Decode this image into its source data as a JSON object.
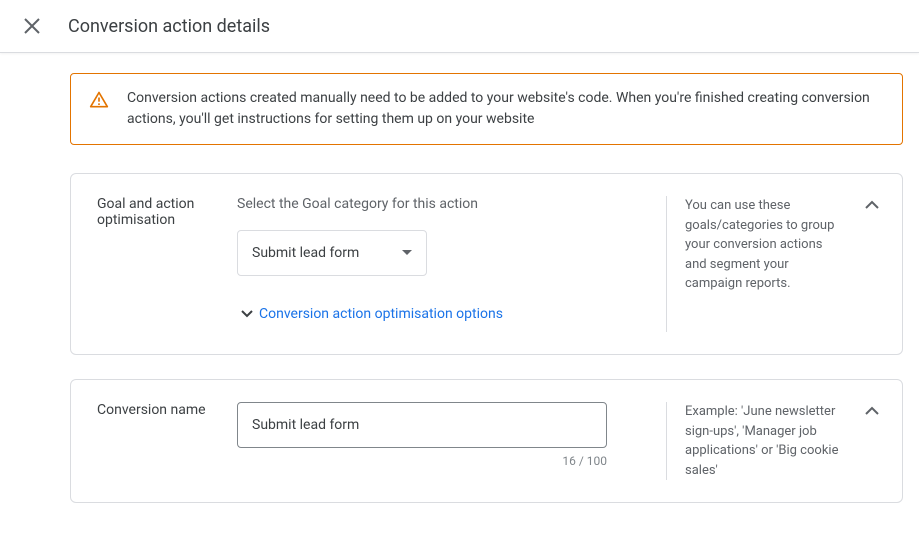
{
  "header": {
    "title": "Conversion action details"
  },
  "alert": {
    "text": "Conversion actions created manually need to be added to your website's code. When you're finished creating conversion actions, you'll get instructions for setting them up on your website"
  },
  "goal_section": {
    "label": "Goal and action optimisation",
    "prompt": "Select the Goal category for this action",
    "select_value": "Submit lead form",
    "expand_link": "Conversion action optimisation options",
    "side_text": "You can use these goals/categories to group your conversion actions and segment your campaign reports."
  },
  "name_section": {
    "label": "Conversion name",
    "input_value": "Submit lead form",
    "counter": "16 / 100",
    "side_text": "Example: 'June newsletter sign-ups', 'Manager job applications' or 'Big cookie sales'"
  }
}
